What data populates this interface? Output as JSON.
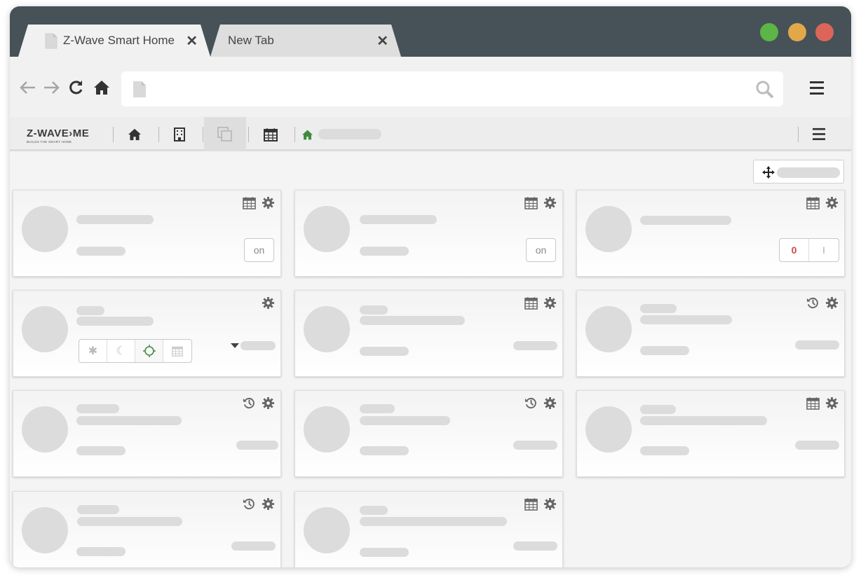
{
  "browser": {
    "tabs": [
      {
        "title": "Z-Wave Smart Home",
        "close": "✕"
      },
      {
        "title": "New Tab",
        "close": "✕"
      }
    ],
    "traffic_colors": {
      "green": "#5cb546",
      "yellow": "#e1a84a",
      "red": "#dc6559"
    },
    "address_value": "",
    "nav_icons": [
      "back-arrow-icon",
      "forward-arrow-icon",
      "reload-icon",
      "home-icon"
    ]
  },
  "app": {
    "logo": {
      "main": "Z-WAVE›ME",
      "sub": "BUILDS THE SMART HOME"
    },
    "nav": [
      "home-icon",
      "building-icon",
      "copy-icon",
      "calendar-icon"
    ],
    "accent": "#3f8a3f"
  },
  "cards": [
    {
      "icons": [
        "calendar-icon",
        "gear-icon"
      ],
      "control": "on",
      "control_label": "on"
    },
    {
      "icons": [
        "calendar-icon",
        "gear-icon"
      ],
      "control": "on",
      "control_label": "on"
    },
    {
      "icons": [
        "calendar-icon",
        "gear-icon"
      ],
      "control": "switch",
      "switch_labels": [
        "0",
        "I"
      ]
    },
    {
      "icons": [
        "gear-icon"
      ],
      "control": "modes"
    },
    {
      "icons": [
        "calendar-icon",
        "gear-icon"
      ],
      "control": "value"
    },
    {
      "icons": [
        "history-icon",
        "gear-icon"
      ],
      "control": "value"
    },
    {
      "icons": [
        "history-icon",
        "gear-icon"
      ],
      "control": "value"
    },
    {
      "icons": [
        "history-icon",
        "gear-icon"
      ],
      "control": "value"
    },
    {
      "icons": [
        "calendar-icon",
        "gear-icon"
      ],
      "control": "value"
    },
    {
      "icons": [
        "history-icon",
        "gear-icon"
      ],
      "control": "value"
    },
    {
      "icons": [
        "calendar-icon",
        "gear-icon"
      ],
      "control": "value"
    }
  ]
}
